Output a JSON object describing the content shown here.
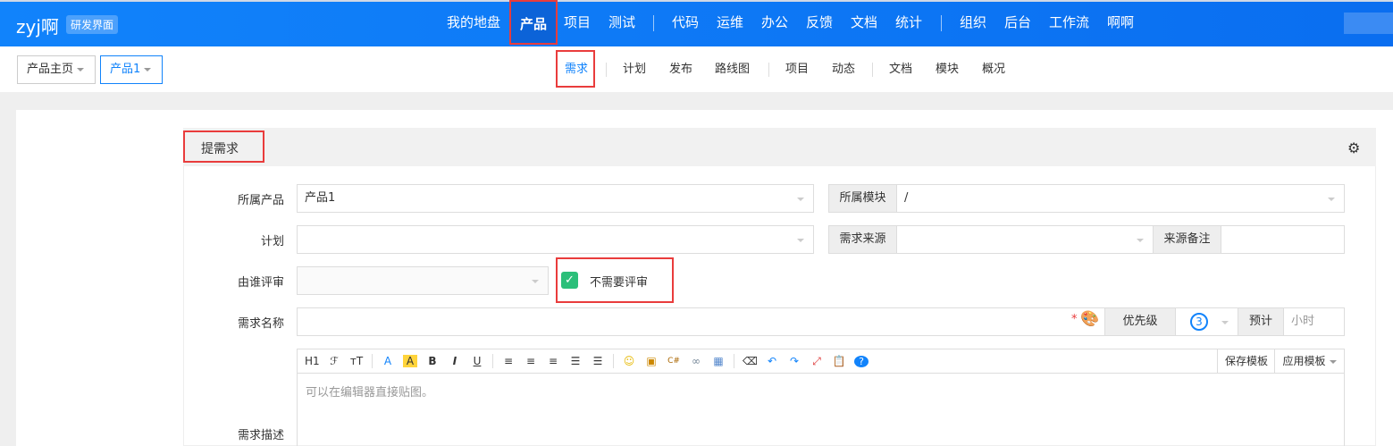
{
  "header": {
    "app_name": "zyj啊",
    "badge": "研发界面",
    "nav": [
      "我的地盘",
      "产品",
      "项目",
      "测试",
      "代码",
      "运维",
      "办公",
      "反馈",
      "文档",
      "统计",
      "组织",
      "后台",
      "工作流",
      "啊啊"
    ],
    "active_nav": "产品"
  },
  "breadcrumb": {
    "home": "产品主页",
    "current": "产品1"
  },
  "subnav": {
    "items": [
      "需求",
      "计划",
      "发布",
      "路线图",
      "项目",
      "动态",
      "文档",
      "模块",
      "概况"
    ],
    "active": "需求"
  },
  "panel": {
    "title": "提需求"
  },
  "form": {
    "product_label": "所属产品",
    "product_value": "产品1",
    "module_label": "所属模块",
    "module_value": "/",
    "plan_label": "计划",
    "plan_value": "",
    "source_label": "需求来源",
    "source_value": "",
    "source_note_label": "来源备注",
    "source_note_value": "",
    "reviewer_label": "由谁评审",
    "reviewer_value": "",
    "no_review_label": "不需要评审",
    "no_review_checked": true,
    "name_label": "需求名称",
    "name_value": "",
    "required_mark": "*",
    "priority_label": "优先级",
    "priority_value": "3",
    "estimate_label": "预计",
    "estimate_placeholder": "小时",
    "desc_label": "需求描述",
    "editor_placeholder": "可以在编辑器直接贴图。",
    "save_template": "保存模板",
    "apply_template": "应用模板"
  },
  "toolbar": [
    "H1",
    "ℱ",
    "тT",
    "A",
    "A",
    "B",
    "I",
    "U",
    "≡",
    "≡",
    "≡",
    "☰",
    "☰",
    "☺",
    "▣",
    "C#",
    "∞",
    "▦",
    "⌫",
    "↶",
    "↷",
    "⤢",
    "📋",
    "?"
  ],
  "colors": {
    "primary": "#1183fb",
    "highlight": "#e93c3c",
    "check": "#2cbf7a"
  }
}
